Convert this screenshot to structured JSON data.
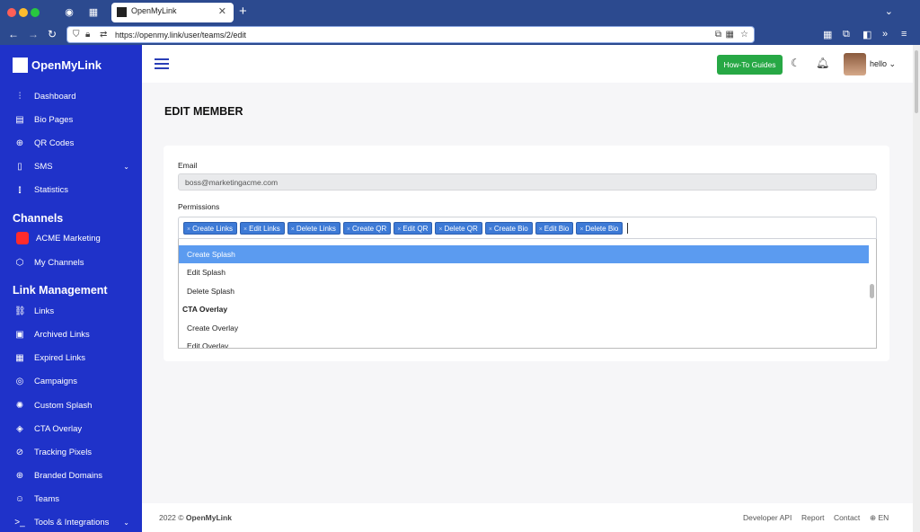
{
  "browser": {
    "tab_title": "OpenMyLink",
    "url": "https://openmy.link/user/teams/2/edit",
    "tab_close": "✕",
    "new_tab": "+"
  },
  "sidebar": {
    "brand": "OpenMyLink",
    "items_top": [
      {
        "label": "Dashboard",
        "icon": "sliders-icon",
        "glyph": "⫶"
      },
      {
        "label": "Bio Pages",
        "icon": "page-icon",
        "glyph": "▤"
      },
      {
        "label": "QR Codes",
        "icon": "globe-icon",
        "glyph": "⊕"
      },
      {
        "label": "SMS",
        "icon": "phone-icon",
        "glyph": "▯"
      },
      {
        "label": "Statistics",
        "icon": "bar-chart-icon",
        "glyph": "⫾"
      }
    ],
    "channels_heading": "Channels",
    "channels": [
      {
        "label": "ACME Marketing"
      },
      {
        "label": "My Channels",
        "icon": "cube-icon",
        "glyph": "⬡"
      }
    ],
    "link_mgmt_heading": "Link Management",
    "link_items": [
      {
        "label": "Links",
        "icon": "link-icon",
        "glyph": "⛓"
      },
      {
        "label": "Archived Links",
        "icon": "briefcase-icon",
        "glyph": "▣"
      },
      {
        "label": "Expired Links",
        "icon": "calendar-icon",
        "glyph": "▦"
      },
      {
        "label": "Campaigns",
        "icon": "target-icon",
        "glyph": "◎"
      },
      {
        "label": "Custom Splash",
        "icon": "loader-icon",
        "glyph": "✺"
      },
      {
        "label": "CTA Overlay",
        "icon": "layers-icon",
        "glyph": "◈"
      },
      {
        "label": "Tracking Pixels",
        "icon": "compass-icon",
        "glyph": "⊘"
      },
      {
        "label": "Branded Domains",
        "icon": "globe-icon",
        "glyph": "⊕"
      },
      {
        "label": "Teams",
        "icon": "users-icon",
        "glyph": "☺"
      },
      {
        "label": "Tools & Integrations",
        "icon": "terminal-icon",
        "glyph": ">_"
      }
    ]
  },
  "header": {
    "howto_label": "How-To Guides",
    "user_name": "hello"
  },
  "main": {
    "page_title": "EDIT MEMBER",
    "email_label": "Email",
    "email_value": "boss@marketingacme.com",
    "permissions_label": "Permissions",
    "tags": [
      "Create Links",
      "Edit Links",
      "Delete Links",
      "Create QR",
      "Edit QR",
      "Delete QR",
      "Create Bio",
      "Edit Bio",
      "Delete Bio"
    ],
    "dropdown_options": [
      {
        "label": "Create Splash",
        "selected": true,
        "group": false
      },
      {
        "label": "Edit Splash",
        "selected": false,
        "group": false
      },
      {
        "label": "Delete Splash",
        "selected": false,
        "group": false
      },
      {
        "label": "CTA Overlay",
        "selected": false,
        "group": true
      },
      {
        "label": "Create Overlay",
        "selected": false,
        "group": false
      },
      {
        "label": "Edit Overlay",
        "selected": false,
        "group": false
      }
    ]
  },
  "footer": {
    "year": "2022",
    "brand": "OpenMyLink",
    "links": [
      "Developer API",
      "Report",
      "Contact"
    ],
    "language": "EN"
  },
  "colors": {
    "sidebar_bg": "#1f32c9",
    "accent_green": "#27a845",
    "tag_blue": "#3d7ad6",
    "selected_option": "#5b9bf0",
    "browser_chrome": "#2c4a8f"
  }
}
